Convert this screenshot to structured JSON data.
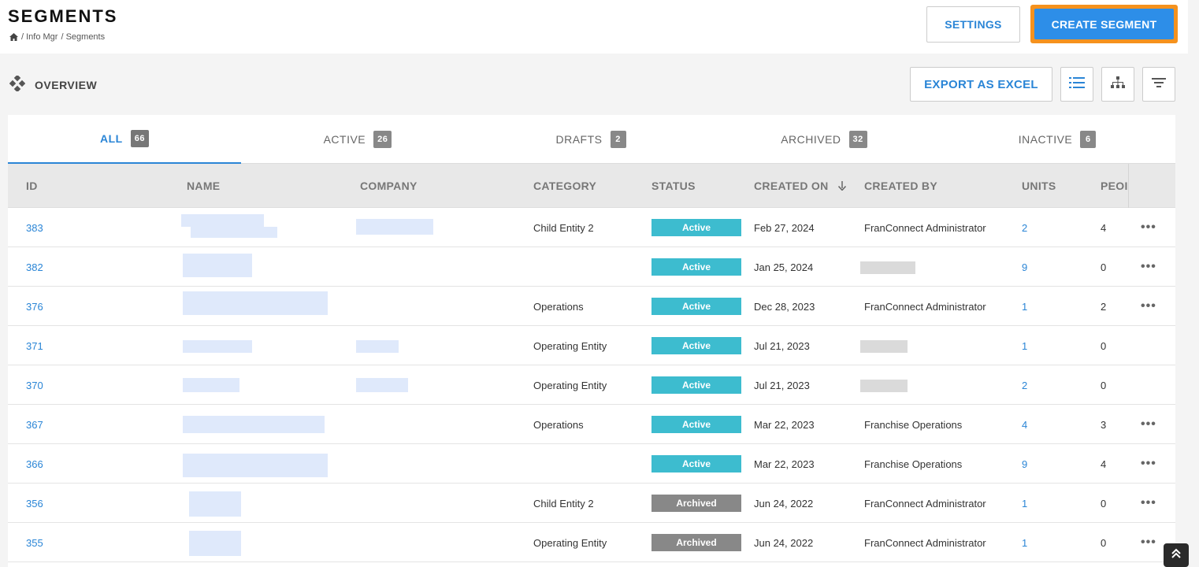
{
  "header": {
    "title": "SEGMENTS",
    "breadcrumb": [
      "/ Info Mgr",
      "/ Segments"
    ],
    "settings_label": "SETTINGS",
    "create_label": "CREATE SEGMENT"
  },
  "overview": {
    "label": "OVERVIEW",
    "export_label": "EXPORT AS EXCEL",
    "icons": [
      "list-view-icon",
      "hierarchy-view-icon",
      "filter-icon"
    ]
  },
  "tabs": [
    {
      "label": "ALL",
      "count": "66"
    },
    {
      "label": "ACTIVE",
      "count": "26"
    },
    {
      "label": "DRAFTS",
      "count": "2"
    },
    {
      "label": "ARCHIVED",
      "count": "32"
    },
    {
      "label": "INACTIVE",
      "count": "6"
    }
  ],
  "columns": [
    "ID",
    "NAME",
    "COMPANY",
    "CATEGORY",
    "STATUS",
    "CREATED ON",
    "CREATED BY",
    "UNITS",
    "PEOI"
  ],
  "rows": [
    {
      "id": "383",
      "category": "Child Entity 2",
      "status": "Active",
      "created_on": "Feb 27, 2024",
      "created_by": "FranConnect Administrator",
      "units": "2",
      "people": "4",
      "more": "•••"
    },
    {
      "id": "382",
      "category": "",
      "status": "Active",
      "created_on": "Jan 25, 2024",
      "created_by": "",
      "units": "9",
      "people": "0",
      "more": "•••"
    },
    {
      "id": "376",
      "category": "Operations",
      "status": "Active",
      "created_on": "Dec 28, 2023",
      "created_by": "FranConnect Administrator",
      "units": "1",
      "people": "2",
      "more": "•••"
    },
    {
      "id": "371",
      "category": "Operating Entity",
      "status": "Active",
      "created_on": "Jul 21, 2023",
      "created_by": "",
      "units": "1",
      "people": "0",
      "more": ""
    },
    {
      "id": "370",
      "category": "Operating Entity",
      "status": "Active",
      "created_on": "Jul 21, 2023",
      "created_by": "",
      "units": "2",
      "people": "0",
      "more": ""
    },
    {
      "id": "367",
      "category": "Operations",
      "status": "Active",
      "created_on": "Mar 22, 2023",
      "created_by": "Franchise Operations",
      "units": "4",
      "people": "3",
      "more": "•••"
    },
    {
      "id": "366",
      "category": "",
      "status": "Active",
      "created_on": "Mar 22, 2023",
      "created_by": "Franchise Operations",
      "units": "9",
      "people": "4",
      "more": "•••"
    },
    {
      "id": "356",
      "category": "Child Entity 2",
      "status": "Archived",
      "created_on": "Jun 24, 2022",
      "created_by": "FranConnect Administrator",
      "units": "1",
      "people": "0",
      "more": "•••"
    },
    {
      "id": "355",
      "category": "Operating Entity",
      "status": "Archived",
      "created_on": "Jun 24, 2022",
      "created_by": "FranConnect Administrator",
      "units": "1",
      "people": "0",
      "more": "•••"
    }
  ],
  "colors": {
    "accent": "#2a85d6",
    "create_bg": "#2d8ee8",
    "create_outline": "#f5921e",
    "status_active": "#3dbccf",
    "status_archived": "#888888"
  }
}
